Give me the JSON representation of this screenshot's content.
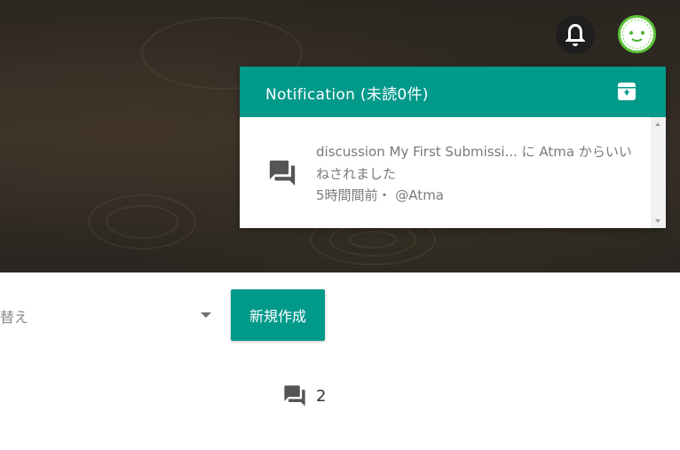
{
  "header": {
    "bell_icon": "bell-icon",
    "avatar": "avatar"
  },
  "notification": {
    "title": "Notification (未読0件)",
    "header_icon": "archive-icon",
    "items": [
      {
        "icon": "forum-icon",
        "text": "discussion My First Submissi... に Atma からいいねされました",
        "meta": "5時間間前・ @Atma"
      }
    ]
  },
  "toolbar": {
    "sort_label": "替え",
    "new_button_label": "新規作成"
  },
  "post": {
    "comment_icon": "forum-icon",
    "comment_count": "2"
  },
  "colors": {
    "accent": "#00998a",
    "avatar_ring": "#5fc43b"
  }
}
